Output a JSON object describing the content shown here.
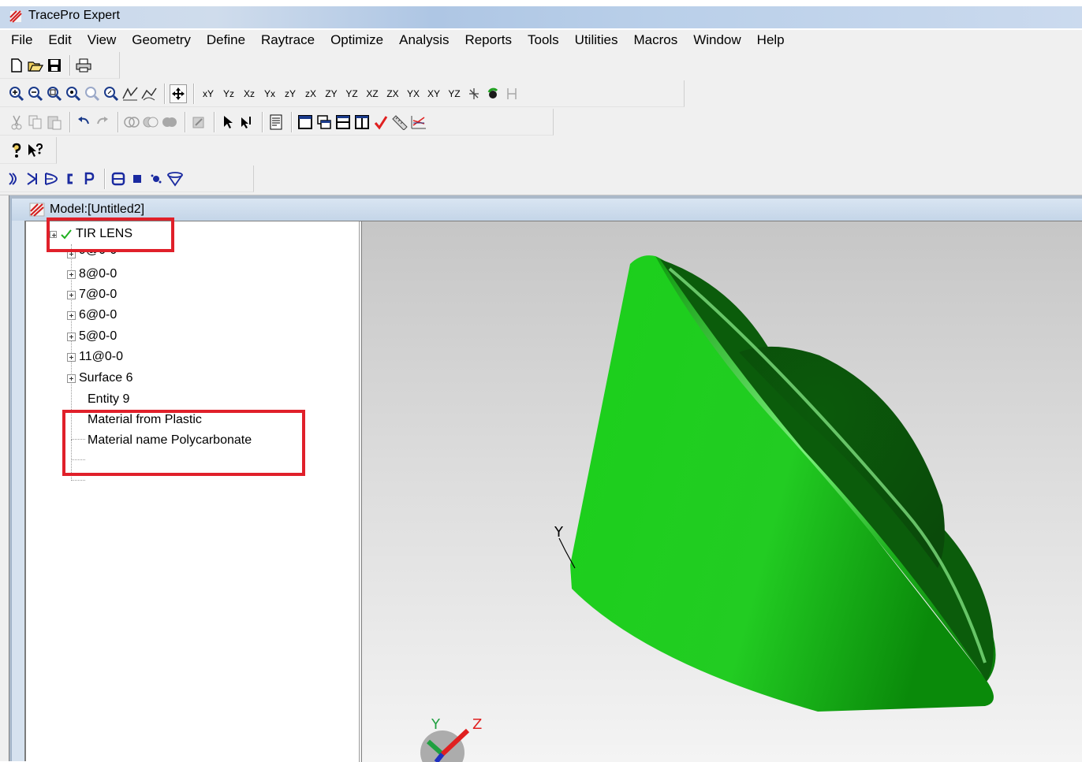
{
  "window": {
    "title": "TracePro Expert"
  },
  "menu": [
    "File",
    "Edit",
    "View",
    "Geometry",
    "Define",
    "Raytrace",
    "Optimize",
    "Analysis",
    "Reports",
    "Tools",
    "Utilities",
    "Macros",
    "Window",
    "Help"
  ],
  "toolbar": {
    "view_axis_labels": [
      "xY",
      "Yz",
      "Xz",
      "Yx",
      "zY",
      "zX",
      "ZY",
      "YZ",
      "XZ",
      "ZX",
      "YX",
      "XY",
      "YZ"
    ]
  },
  "document": {
    "title": "Model:[Untitled2]"
  },
  "tree": {
    "root": "TIR LENS",
    "children": [
      "9@0-0",
      "8@0-0",
      "7@0-0",
      "6@0-0",
      "5@0-0",
      "11@0-0",
      "Surface 6"
    ],
    "leaves": [
      "Entity 9",
      "Material from Plastic",
      "Material name Polycarbonate"
    ]
  },
  "viewport": {
    "axis_labels": {
      "y_small": "Y",
      "triad_y": "Y",
      "triad_z": "Z"
    }
  },
  "colors": {
    "highlight": "#e0202a",
    "lens_green": "#1fd11f",
    "check_green": "#20b020"
  }
}
